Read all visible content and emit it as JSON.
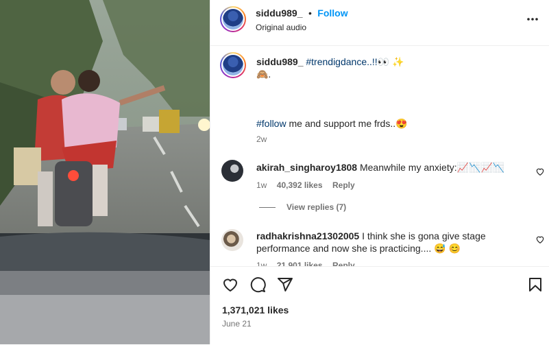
{
  "post": {
    "username": "siddu989_",
    "follow_label": "Follow",
    "audio_label": "Original audio",
    "more_icon": "more-horizontal-icon",
    "caption": {
      "username": "siddu989_",
      "hashtag1": "#trendigdance..!!👀 ✨",
      "line2": "🙈.",
      "hashtag2": "#follow",
      "line3": " me and support me frds..😍",
      "time": "2w"
    }
  },
  "comments": [
    {
      "username": "akirah_singharoy1808",
      "text": "Meanwhile my anxiety:📈📉📈📉",
      "time": "1w",
      "likes": "40,392 likes",
      "reply": "Reply",
      "view_replies": "View replies (7)"
    },
    {
      "username": "radhakrishna21302005",
      "text_line1": "I think she is gona give stage",
      "text_line2": "performance and now she is practicing.... 😅 😊",
      "time": "1w",
      "likes": "21,901 likes",
      "reply": "Reply"
    }
  ],
  "footer": {
    "likes": "1,371,021 likes",
    "date": "June 21"
  }
}
